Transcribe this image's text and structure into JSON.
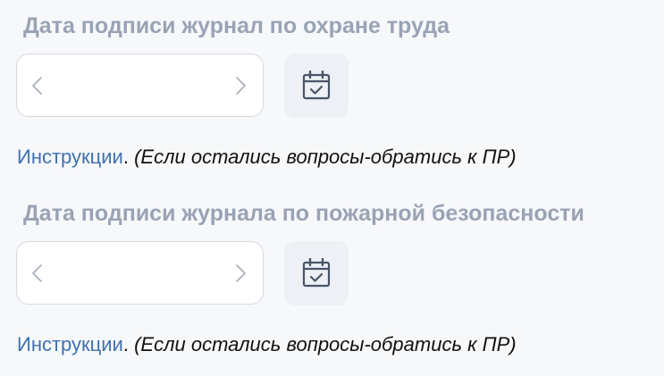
{
  "fields": [
    {
      "title": "Дата подписи журнал по охране труда",
      "value": "",
      "link_text": "Инструкции",
      "period": ".",
      "note": "(Если остались вопросы-обратись к ПР)"
    },
    {
      "title": "Дата подписи журнала по пожарной безопасности",
      "value": "",
      "link_text": "Инструкции",
      "period": ".",
      "note": "(Если остались вопросы-обратись к ПР)"
    }
  ],
  "icons": {
    "prev": "chevron-left-icon",
    "next": "chevron-right-icon",
    "calendar": "calendar-check-icon"
  },
  "colors": {
    "title": "#9aa3b5",
    "link": "#3f72b0",
    "field_border": "#d5d9e0",
    "button_bg": "#edf0f5",
    "icon": "#4a5568"
  }
}
